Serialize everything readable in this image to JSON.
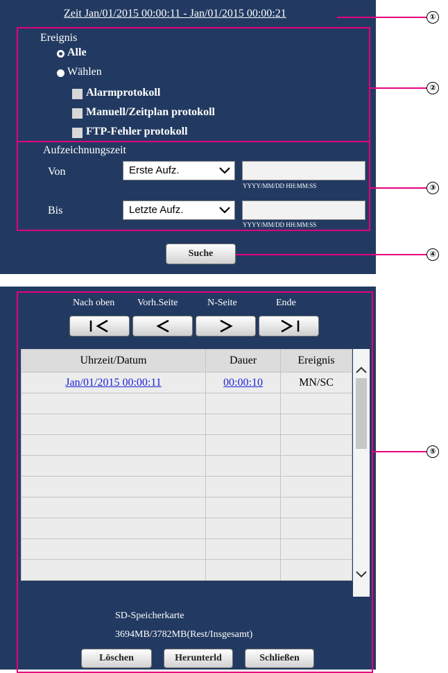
{
  "header": {
    "time_range": "Zeit Jan/01/2015 00:00:11 - Jan/01/2015 00:00:21"
  },
  "event": {
    "title": "Ereignis",
    "radio_all": "Alle",
    "radio_select": "Wählen",
    "checkboxes": [
      "Alarmprotokoll",
      "Manuell/Zeitplan protokoll",
      "FTP-Fehler protokoll"
    ]
  },
  "record_time": {
    "title": "Aufzeichnungszeit",
    "from_label": "Von",
    "from_select": "Erste Aufz.",
    "to_label": "Bis",
    "to_select": "Letzte Aufz.",
    "format_hint": "YYYY/MM/DD HH:MM:SS"
  },
  "search_button": "Suche",
  "nav": {
    "top": "Nach oben",
    "prev": "Vorh.Seite",
    "next": "N-Seite",
    "end": "Ende"
  },
  "table": {
    "headers": [
      "Uhrzeit/Datum",
      "Dauer",
      "Ereignis"
    ],
    "rows": [
      {
        "datetime": "Jan/01/2015  00:00:11",
        "duration": "00:00:10",
        "event": "MN/SC"
      }
    ]
  },
  "sd_card": {
    "label": "SD-Speicherkarte",
    "usage": "3694MB/3782MB(Rest/Insgesamt)"
  },
  "buttons": {
    "delete": "Löschen",
    "download": "Herunterld",
    "close": "Schließen"
  },
  "callouts": [
    "①",
    "②",
    "③",
    "④",
    "⑤"
  ],
  "colors": {
    "panel": "#223a61",
    "callout_line": "#e6007e",
    "link": "#1a20d6"
  }
}
